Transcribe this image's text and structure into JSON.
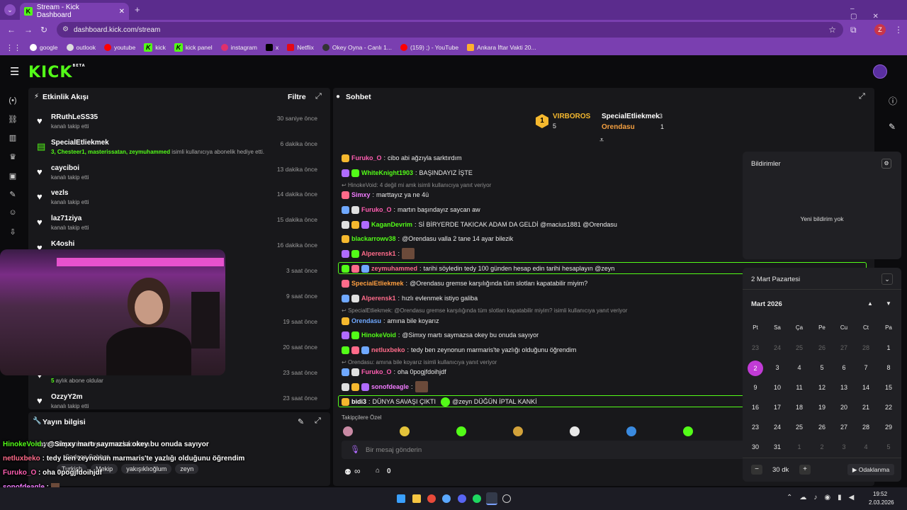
{
  "browser": {
    "tab_title": "Stream - Kick Dashboard",
    "url": "dashboard.kick.com/stream",
    "profile_initial": "Z",
    "bookmarks": [
      "google",
      "outlook",
      "youtube",
      "kick",
      "kick panel",
      "instagram",
      "x",
      "Netflix",
      "Okey Oyna - Canlı 1...",
      "(159) ;) - YouTube",
      "Ankara İftar Vakti 20..."
    ]
  },
  "header": {
    "logo": "KICK",
    "logo_tag": "BETA"
  },
  "activity": {
    "title": "Etkinlik Akışı",
    "filter_label": "Filtre",
    "items": [
      {
        "name": "RRuthLeSS35",
        "sub": "kanalı takip etti",
        "time": "30 saniye önce"
      },
      {
        "name": "SpecialEtliekmek",
        "sub_highlight": "3, Chesteer1, masterissatan, zeymuhammed",
        "sub": " isimli kullanıcıya abonelik hediye etti.",
        "time": "6 dakika önce"
      },
      {
        "name": "cayciboi",
        "sub": "kanalı takip etti",
        "time": "13 dakika önce"
      },
      {
        "name": "vezls",
        "sub": "kanalı takip etti",
        "time": "14 dakika önce"
      },
      {
        "name": "laz71ziya",
        "sub": "kanalı takip etti",
        "time": "15 dakika önce"
      },
      {
        "name": "K4oshi",
        "sub": "",
        "time": "16 dakika önce"
      },
      {
        "name": "",
        "sub": "",
        "time": "3 saat önce"
      },
      {
        "name": "",
        "sub": "",
        "time": "9 saat önce"
      },
      {
        "name": "",
        "sub": "",
        "time": "19 saat önce"
      },
      {
        "name": "",
        "sub": "",
        "time": "20 saat önce"
      },
      {
        "name": "",
        "sub_highlight": "5",
        "sub": " aylık abone oldular",
        "time": "23 saat önce"
      },
      {
        "name": "OzzyY2m",
        "sub": "kanalı takip etti",
        "time": "23 saat önce"
      }
    ]
  },
  "stream_info": {
    "title": "Yayın bilgisi",
    "stream_title": "hayırlı akşamlar #oyunumadokunma",
    "chat_mode": "Sadece Sohbet",
    "tags": [
      "Turkish",
      "Mekip",
      "yakışıklıoğlum",
      "zeyn"
    ]
  },
  "chat": {
    "title": "Sohbet",
    "leaderboard": [
      {
        "rank": "1",
        "name": "VIRBOROS",
        "count": "5"
      },
      {
        "name": "SpecialEtliekmek",
        "count": "3"
      },
      {
        "name": "Orendasu",
        "count": "1"
      }
    ],
    "messages": [
      {
        "user": "Furuko_O",
        "color": "#ff5eb1",
        "text": "cibo abi ağzıyla sarktırdım"
      },
      {
        "user": "WhiteKnight1903",
        "color": "#53fc18",
        "text": "BAŞINDAYIZ İŞTE"
      },
      {
        "reply": "HinokeVoid: 4 değil mi amk isimli kullanıcıya yanıt veriyor"
      },
      {
        "user": "Simxy",
        "color": "#f27bff",
        "text": "marttayız ya ne 4ü"
      },
      {
        "user": "Furuko_O",
        "color": "#ff5eb1",
        "text": "martın başındayız saycan aw"
      },
      {
        "user": "KaganDevrim",
        "color": "#53fc18",
        "text": "Sİ BİRYERDE TAKICAK ADAM DA GELDİ @macius1881 @Orendasu"
      },
      {
        "user": "blackarrowv38",
        "color": "#53fc18",
        "text": "@Orendasu valla 2 tane 14 ayar bilezik"
      },
      {
        "user": "Alperensk1",
        "color": "#ff6b8a",
        "text": ""
      },
      {
        "user": "zeymuhammed",
        "color": "#ff6b8a",
        "text": "tarihi söyledin tedy 100 günden hesap edin tarihi hesaplayın @zeyn"
      },
      {
        "user": "SpecialEtliekmek",
        "color": "#ff9f40",
        "text": "@Orendasu gremse karşılığında tüm slotları kapatabilir miyim?"
      },
      {
        "user": "Alperensk1",
        "color": "#ff6b8a",
        "text": "hızlı evlenmek istiyo galiba"
      },
      {
        "reply": "SpecialEtliekmek: @Orendasu gremse karşılığında tüm slotları kapatabilir miyim? isimli kullanıcıya yanıt veriyor"
      },
      {
        "user": "Orendasu",
        "color": "#6fa8ff",
        "text": "amına bile koyarız"
      },
      {
        "user": "HinokeVoid",
        "color": "#53fc18",
        "text": "@Simxy martı saymazsa okey bu onuda sayıyor"
      },
      {
        "user": "netluxbeko",
        "color": "#ff6b8a",
        "text": "tedy ben zeynonun marmaris'te yazlığı olduğunu öğrendim"
      },
      {
        "reply": "Orendasu: amına bile koyarız isimli kullanıcıya yanıt veriyor"
      },
      {
        "user": "Furuko_O",
        "color": "#ff5eb1",
        "text": "oha 0pogjfdoihjdf"
      },
      {
        "user": "sonofdeagle",
        "color": "#f27bff",
        "text": ""
      },
      {
        "user": "bidi3",
        "color": "#ffffff",
        "text": "DÜNYA SAVAŞI ÇIKTI",
        "text2": "@zeyn DÜĞÜN İPTAL KANKİ"
      }
    ],
    "emote_label": "Takipçilere Özel",
    "input_placeholder": "Bir mesaj gönderin",
    "footer_count": "0",
    "footer_infinity": "∞"
  },
  "notifications": {
    "title": "Bildirimler",
    "empty": "Yeni bildirim yok"
  },
  "calendar": {
    "selected_label": "2 Mart Pazartesi",
    "month": "Mart 2026",
    "weekdays": [
      "Pt",
      "Sa",
      "Ça",
      "Pe",
      "Cu",
      "Ct",
      "Pa"
    ],
    "days": [
      "23",
      "24",
      "25",
      "26",
      "27",
      "28",
      "1",
      "2",
      "3",
      "4",
      "5",
      "6",
      "7",
      "8",
      "9",
      "10",
      "11",
      "12",
      "13",
      "14",
      "15",
      "16",
      "17",
      "18",
      "19",
      "20",
      "21",
      "22",
      "23",
      "24",
      "25",
      "26",
      "27",
      "28",
      "29",
      "30",
      "31",
      "1",
      "2",
      "3",
      "4",
      "5"
    ],
    "selected_day_index": 7,
    "focus_value": "30 dk",
    "focus_label": "Odaklanma"
  },
  "overlay_chat": [
    {
      "user": "HinokeVoid",
      "text": "@Simxy martı saymazsa okey bu onuda sayıyor"
    },
    {
      "user": "netluxbeko",
      "text": "tedy ben zeynonun marmaris'te yazlığı olduğunu öğrendim"
    },
    {
      "user": "Furuko_O",
      "text": "oha 0pogjfdoihjdf"
    },
    {
      "user": "sonofdeagle",
      "text": ""
    },
    {
      "user": "bidi3",
      "text": "DÜNYA SAVAŞI ÇIKTI",
      "text2": "@zeyn DÜĞÜN İPTAL KANKİ"
    }
  ],
  "taskbar": {
    "time": "19:52",
    "date": "2.03.2026"
  },
  "colors": {
    "brand": "#53fc18",
    "chrome": "#7a3fb0",
    "panel": "#18181b"
  }
}
